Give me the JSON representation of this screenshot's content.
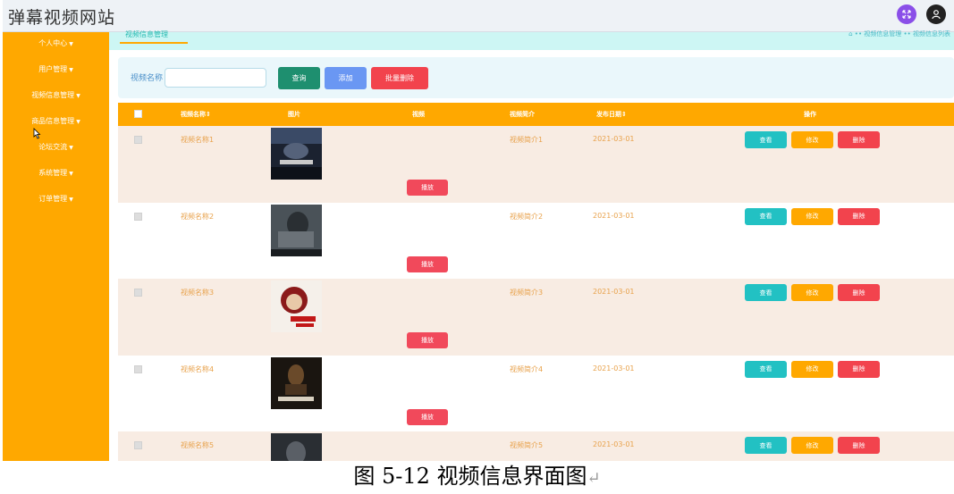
{
  "header": {
    "site_title": "弹幕视频网站",
    "icons": [
      "fullscreen-icon",
      "user-icon"
    ],
    "colors": {
      "fullscreen": "#8a4fe8",
      "user": "#222222"
    }
  },
  "sidebar": {
    "background": "#ffa800",
    "items": [
      {
        "label": "个人中心"
      },
      {
        "label": "用户管理"
      },
      {
        "label": "视频信息管理"
      },
      {
        "label": "商品信息管理"
      },
      {
        "label": "论坛交流"
      },
      {
        "label": "系统管理"
      },
      {
        "label": "订单管理"
      }
    ]
  },
  "tabs": {
    "active": "视频信息管理"
  },
  "breadcrumb": {
    "text": "⌂ •• 视频信息管理 •• 视频信息列表"
  },
  "search": {
    "label": "视频名称",
    "value": "",
    "placeholder": "",
    "search_button": "查询",
    "add_button": "添加",
    "batch_delete_button": "批量删除"
  },
  "table": {
    "headers": [
      "视频名称⇕",
      "图片",
      "视频",
      "视频简介",
      "发布日期⇕",
      "操作"
    ],
    "play_label": "播放",
    "view_label": "查看",
    "edit_label": "修改",
    "delete_label": "删除",
    "rows": [
      {
        "name": "视频名称1",
        "intro": "视频简介1",
        "date": "2021-03-01"
      },
      {
        "name": "视频名称2",
        "intro": "视频简介2",
        "date": "2021-03-01"
      },
      {
        "name": "视频名称3",
        "intro": "视频简介3",
        "date": "2021-03-01"
      },
      {
        "name": "视频名称4",
        "intro": "视频简介4",
        "date": "2021-03-01"
      },
      {
        "name": "视频名称5",
        "intro": "视频简介5",
        "date": "2021-03-01"
      }
    ]
  },
  "caption": {
    "text": "图 5-12 视频信息界面图",
    "return_mark": "↵"
  }
}
